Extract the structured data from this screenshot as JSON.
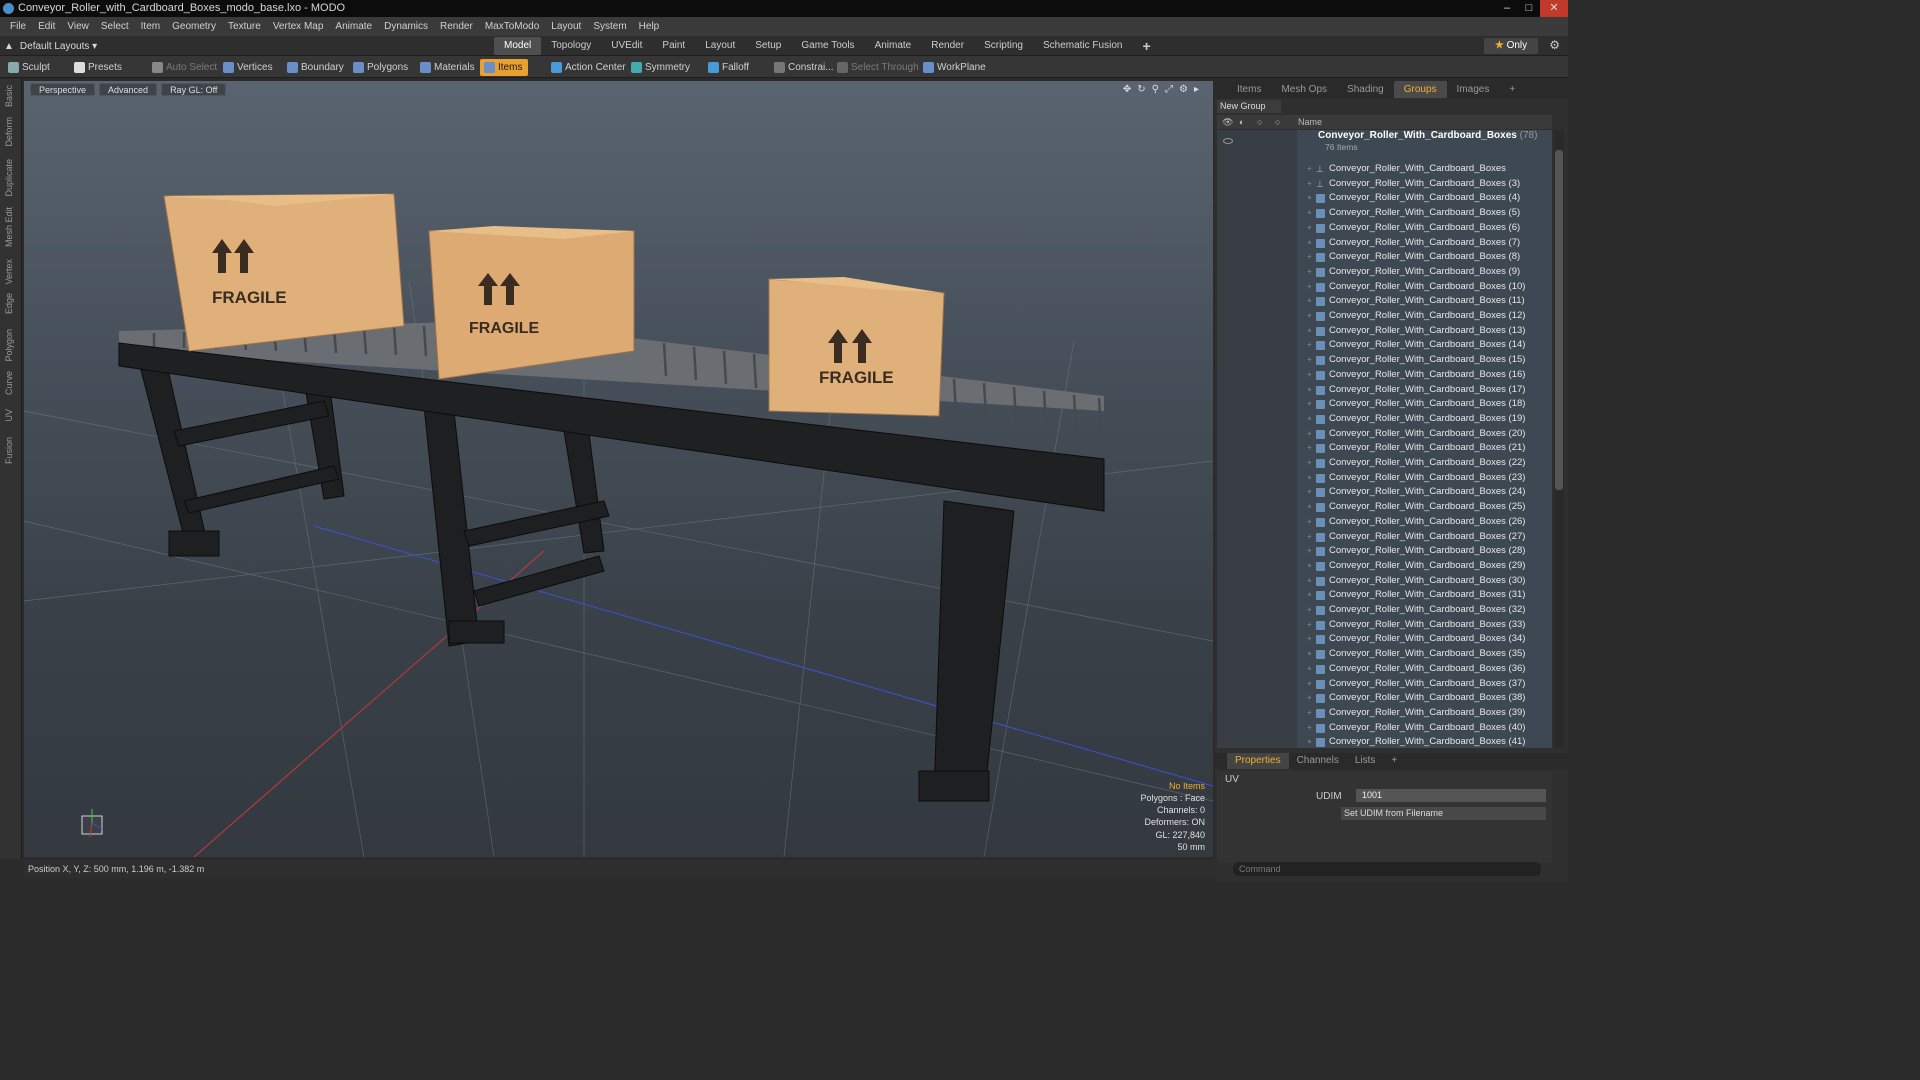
{
  "window": {
    "title": "Conveyor_Roller_with_Cardboard_Boxes_modo_base.lxo - MODO"
  },
  "menu": [
    "File",
    "Edit",
    "View",
    "Select",
    "Item",
    "Geometry",
    "Texture",
    "Vertex Map",
    "Animate",
    "Dynamics",
    "Render",
    "MaxToModo",
    "Layout",
    "System",
    "Help"
  ],
  "layout": {
    "selector": "Default Layouts ▾",
    "tabs": [
      "Model",
      "Topology",
      "UVEdit",
      "Paint",
      "Layout",
      "Setup",
      "Game Tools",
      "Animate",
      "Render",
      "Scripting",
      "Schematic Fusion",
      "+"
    ],
    "active_tab": "Model",
    "only_label": "Only"
  },
  "toolbar": [
    "Sculpt",
    "Presets",
    "Auto Select",
    "Vertices",
    "Boundary",
    "Polygons",
    "Materials",
    "Items",
    "Action Center",
    "Symmetry",
    "Falloff",
    "Constrai...",
    "Select Through",
    "WorkPlane"
  ],
  "left_tabs": [
    "Basic",
    "Deform",
    "Duplicate",
    "Mesh Edit",
    "Vertex",
    "Edge",
    "Polygon",
    "Curve",
    "UV",
    "Fusion"
  ],
  "viewport": {
    "buttons": [
      "Perspective",
      "Advanced",
      "Ray GL: Off"
    ],
    "box_label": "FRAGILE",
    "info": {
      "no_items": "No Items",
      "polygons": "Polygons : Face",
      "channels": "Channels: 0",
      "deformers": "Deformers: ON",
      "gl": "GL: 227,840",
      "scale": "50 mm"
    }
  },
  "status": {
    "position": "Position X, Y, Z:   500 mm, 1.196 m, -1.382 m"
  },
  "panel": {
    "tabs": [
      "Items",
      "Mesh Ops",
      "Shading",
      "Groups",
      "Images",
      "+"
    ],
    "active_tab": "Groups",
    "new_group": "New Group",
    "name_header": "Name",
    "group": {
      "name": "Conveyor_Roller_With_Cardboard_Boxes",
      "count": "(78)",
      "sub": "76 Items"
    },
    "items": [
      "Conveyor_Roller_With_Cardboard_Boxes",
      "Conveyor_Roller_With_Cardboard_Boxes (3)",
      "Conveyor_Roller_With_Cardboard_Boxes (4)",
      "Conveyor_Roller_With_Cardboard_Boxes (5)",
      "Conveyor_Roller_With_Cardboard_Boxes (6)",
      "Conveyor_Roller_With_Cardboard_Boxes (7)",
      "Conveyor_Roller_With_Cardboard_Boxes (8)",
      "Conveyor_Roller_With_Cardboard_Boxes (9)",
      "Conveyor_Roller_With_Cardboard_Boxes (10)",
      "Conveyor_Roller_With_Cardboard_Boxes (11)",
      "Conveyor_Roller_With_Cardboard_Boxes (12)",
      "Conveyor_Roller_With_Cardboard_Boxes (13)",
      "Conveyor_Roller_With_Cardboard_Boxes (14)",
      "Conveyor_Roller_With_Cardboard_Boxes (15)",
      "Conveyor_Roller_With_Cardboard_Boxes (16)",
      "Conveyor_Roller_With_Cardboard_Boxes (17)",
      "Conveyor_Roller_With_Cardboard_Boxes (18)",
      "Conveyor_Roller_With_Cardboard_Boxes (19)",
      "Conveyor_Roller_With_Cardboard_Boxes (20)",
      "Conveyor_Roller_With_Cardboard_Boxes (21)",
      "Conveyor_Roller_With_Cardboard_Boxes (22)",
      "Conveyor_Roller_With_Cardboard_Boxes (23)",
      "Conveyor_Roller_With_Cardboard_Boxes (24)",
      "Conveyor_Roller_With_Cardboard_Boxes (25)",
      "Conveyor_Roller_With_Cardboard_Boxes (26)",
      "Conveyor_Roller_With_Cardboard_Boxes (27)",
      "Conveyor_Roller_With_Cardboard_Boxes (28)",
      "Conveyor_Roller_With_Cardboard_Boxes (29)",
      "Conveyor_Roller_With_Cardboard_Boxes (30)",
      "Conveyor_Roller_With_Cardboard_Boxes (31)",
      "Conveyor_Roller_With_Cardboard_Boxes (32)",
      "Conveyor_Roller_With_Cardboard_Boxes (33)",
      "Conveyor_Roller_With_Cardboard_Boxes (34)",
      "Conveyor_Roller_With_Cardboard_Boxes (35)",
      "Conveyor_Roller_With_Cardboard_Boxes (36)",
      "Conveyor_Roller_With_Cardboard_Boxes (37)",
      "Conveyor_Roller_With_Cardboard_Boxes (38)",
      "Conveyor_Roller_With_Cardboard_Boxes (39)",
      "Conveyor_Roller_With_Cardboard_Boxes (40)",
      "Conveyor_Roller_With_Cardboard_Boxes (41)"
    ],
    "props_tabs": [
      "Properties",
      "Channels",
      "Lists",
      "+"
    ],
    "uv_label": "UV",
    "udim_label": "UDIM",
    "udim_value": "1001",
    "set_udim": "Set UDIM from Filename",
    "command_placeholder": "Command"
  },
  "colors": {
    "accent": "#f0b030",
    "viewport_bg": "#47505a",
    "box": "#e0b07a"
  }
}
